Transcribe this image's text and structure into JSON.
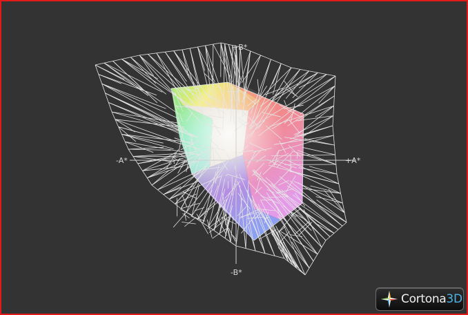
{
  "viewer": {
    "frame_color": "#e31a1a",
    "background_color": "#333333",
    "wireframe_color": "#e6e6e6"
  },
  "axes": {
    "plus_b": "+B*",
    "minus_b": "-B*",
    "minus_a": "-A*",
    "plus_a": "+A*"
  },
  "badge": {
    "brand": "Cortona",
    "suffix": "3D",
    "icon": "cortona-star-icon"
  },
  "gamut_colors": {
    "green": "#9ee86a",
    "yellow": "#f0ea6a",
    "orange": "#f29a5a",
    "red": "#f07a78",
    "pink": "#f09ad6",
    "violet": "#b07ee6",
    "blue": "#8a9ef0",
    "cyan": "#8ee8c8",
    "white": "#f4f2ee"
  }
}
